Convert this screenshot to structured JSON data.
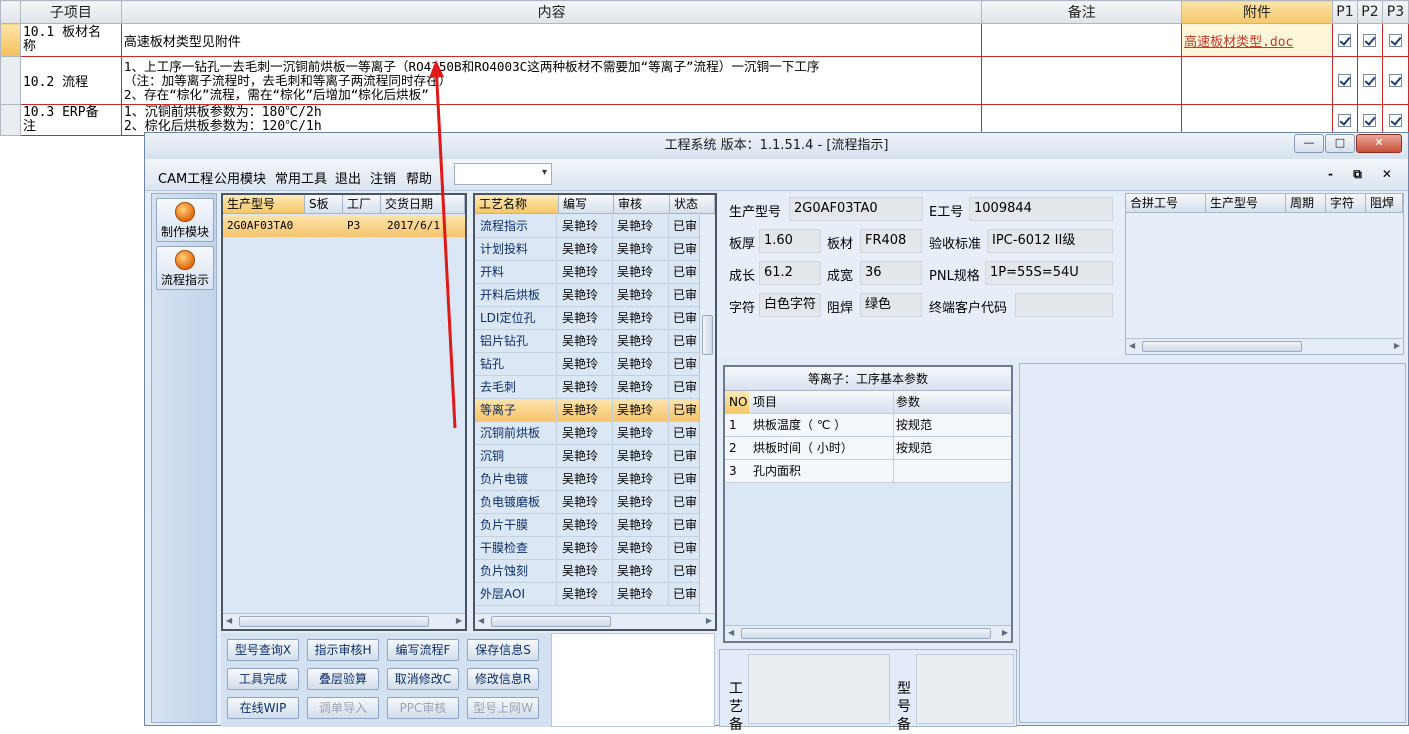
{
  "sheet": {
    "headers": [
      "子项目",
      "内容",
      "备注",
      "附件",
      "P1",
      "P2",
      "P3"
    ],
    "rows": [
      {
        "item": "10.1 板材名称",
        "item_l1": "10.1 板材名",
        "item_l2": "称",
        "content_l1": "高速板材类型见附件",
        "content_l2": "",
        "content_l3": "",
        "attachment": "高速板材类型.doc"
      },
      {
        "item": "10.2 流程",
        "item_l1": "10.2 流程",
        "item_l2": "",
        "content_l1": "1、上工序一钻孔一去毛刺一沉铜前烘板一等离子（RO4350B和RO4003C这两种板材不需要加“等离子”流程）一沉铜一下工序",
        "content_l2": "（注：加等离子流程时，去毛刺和等离子两流程同时存在）",
        "content_l3": "2、存在“棕化”流程，需在“棕化”后增加“棕化后烘板”",
        "attachment": ""
      },
      {
        "item": "10.3 ERP备注",
        "item_l1": "10.3 ERP备",
        "item_l2": "注",
        "content_l1": "1、沉铜前烘板参数为：180℃/2h",
        "content_l2": "2、棕化后烘板参数为：120℃/1h",
        "content_l3": "",
        "attachment": ""
      }
    ]
  },
  "window": {
    "title": "工程系统  版本：1.1.51.4 - [流程指示]",
    "controls": {
      "min": "—",
      "max": "□",
      "close": "✕"
    },
    "mdi_controls": "- ⧉ ✕"
  },
  "menu": [
    "CAM工程",
    "公用模块",
    "常用工具",
    "退出",
    "注销",
    "帮助"
  ],
  "nav": [
    {
      "label": "制作模块",
      "icon": "gear-icon"
    },
    {
      "label": "流程指示",
      "icon": "flow-icon"
    }
  ],
  "product_list": {
    "headers": [
      "生产型号",
      "S板",
      "工厂",
      "交货日期"
    ],
    "row": {
      "model": "2G0AF03TA0",
      "s": "",
      "factory": "P3",
      "date": "2017/6/1"
    }
  },
  "process_list": {
    "headers": [
      "工艺名称",
      "编写",
      "审核",
      "状态"
    ],
    "rows": [
      {
        "name": "流程指示",
        "writer": "吴艳玲",
        "reviewer": "吴艳玲",
        "status": "已审"
      },
      {
        "name": "计划投料",
        "writer": "吴艳玲",
        "reviewer": "吴艳玲",
        "status": "已审"
      },
      {
        "name": "开料",
        "writer": "吴艳玲",
        "reviewer": "吴艳玲",
        "status": "已审"
      },
      {
        "name": "开料后烘板",
        "writer": "吴艳玲",
        "reviewer": "吴艳玲",
        "status": "已审"
      },
      {
        "name": "LDI定位孔",
        "writer": "吴艳玲",
        "reviewer": "吴艳玲",
        "status": "已审"
      },
      {
        "name": "铝片钻孔",
        "writer": "吴艳玲",
        "reviewer": "吴艳玲",
        "status": "已审"
      },
      {
        "name": "钻孔",
        "writer": "吴艳玲",
        "reviewer": "吴艳玲",
        "status": "已审"
      },
      {
        "name": "去毛刺",
        "writer": "吴艳玲",
        "reviewer": "吴艳玲",
        "status": "已审"
      },
      {
        "name": "等离子",
        "writer": "吴艳玲",
        "reviewer": "吴艳玲",
        "status": "已审"
      },
      {
        "name": "沉铜前烘板",
        "writer": "吴艳玲",
        "reviewer": "吴艳玲",
        "status": "已审"
      },
      {
        "name": "沉铜",
        "writer": "吴艳玲",
        "reviewer": "吴艳玲",
        "status": "已审"
      },
      {
        "name": "负片电镀",
        "writer": "吴艳玲",
        "reviewer": "吴艳玲",
        "status": "已审"
      },
      {
        "name": "负电镀磨板",
        "writer": "吴艳玲",
        "reviewer": "吴艳玲",
        "status": "已审"
      },
      {
        "name": "负片干膜",
        "writer": "吴艳玲",
        "reviewer": "吴艳玲",
        "status": "已审"
      },
      {
        "name": "干膜检查",
        "writer": "吴艳玲",
        "reviewer": "吴艳玲",
        "status": "已审"
      },
      {
        "name": "负片蚀刻",
        "writer": "吴艳玲",
        "reviewer": "吴艳玲",
        "status": "已审"
      },
      {
        "name": "外层AOI",
        "writer": "吴艳玲",
        "reviewer": "吴艳玲",
        "status": "已审"
      }
    ],
    "selected_index": 8
  },
  "info": {
    "model_label": "生产型号",
    "model": "2G0AF03TA0",
    "eno_label": "E工号",
    "eno": "1009844",
    "thick_label": "板厚",
    "thick": "1.60",
    "material_label": "板材",
    "material": "FR408",
    "accept_label": "验收标准",
    "accept": "IPC-6012 II级",
    "len_label": "成长",
    "len": "61.2",
    "wid_label": "成宽",
    "wid": "36",
    "pnl_label": "PNL规格",
    "pnl": "1P=55S=54U",
    "char_label": "字符",
    "char": "白色字符",
    "mask_label": "阻焊",
    "mask": "绿色",
    "cust_label": "终端客户代码",
    "cust": ""
  },
  "merge_table": {
    "headers": [
      "合拼工号",
      "生产型号",
      "周期",
      "字符",
      "阻焊"
    ]
  },
  "params": {
    "title": "等离子：工序基本参数",
    "headers": [
      "NO",
      "项目",
      "参数"
    ],
    "rows": [
      {
        "no": "1",
        "item": "烘板温度（ ℃ ）",
        "value": "按规范"
      },
      {
        "no": "2",
        "item": "烘板时间（ 小时）",
        "value": "按规范"
      },
      {
        "no": "3",
        "item": "孔内面积",
        "value": ""
      }
    ]
  },
  "buttons": [
    {
      "label": "型号查询X",
      "enabled": true
    },
    {
      "label": "指示审核H",
      "enabled": true
    },
    {
      "label": "编写流程F",
      "enabled": true
    },
    {
      "label": "保存信息S",
      "enabled": true
    },
    {
      "label": "工具完成",
      "enabled": true
    },
    {
      "label": "叠层验算",
      "enabled": true
    },
    {
      "label": "取消修改C",
      "enabled": true
    },
    {
      "label": "修改信息R",
      "enabled": true
    },
    {
      "label": "在线WIP",
      "enabled": true
    },
    {
      "label": "调单导入",
      "enabled": false
    },
    {
      "label": "PPC审核",
      "enabled": false
    },
    {
      "label": "型号上网W",
      "enabled": false
    }
  ],
  "bottom_labels": {
    "left": "工艺备",
    "right": "型号备"
  }
}
